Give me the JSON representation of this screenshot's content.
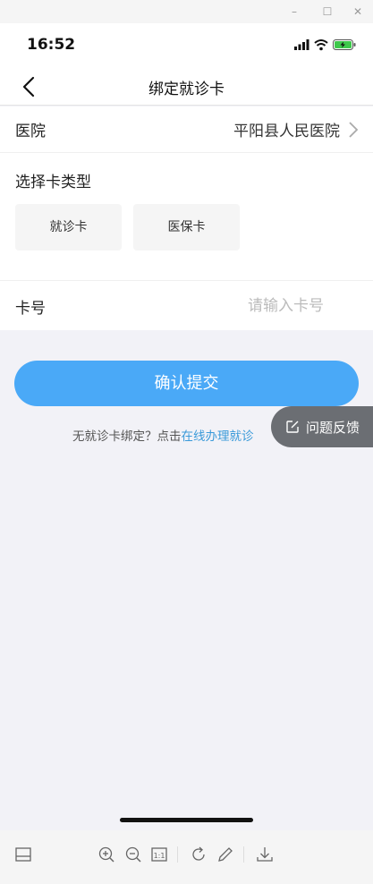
{
  "window_controls": {
    "minimize": "–",
    "maximize": "☐",
    "close": "✕"
  },
  "status_bar": {
    "time": "16:52"
  },
  "nav": {
    "title": "绑定就诊卡"
  },
  "form": {
    "hospital_label": "医院",
    "hospital_value": "平阳县人民医院",
    "card_type_label": "选择卡类型",
    "card_types": [
      "就诊卡",
      "医保卡"
    ],
    "card_number_label": "卡号",
    "card_number_placeholder": "请输入卡号",
    "card_number_value": ""
  },
  "submit": {
    "label": "确认提交"
  },
  "hint": {
    "text": "无就诊卡绑定？点击",
    "link": "在线办理就诊"
  },
  "feedback": {
    "label": "问题反馈"
  },
  "colors": {
    "primary": "#4aa9f7",
    "link": "#3a9ad9",
    "feedback_bg": "#6b6e73",
    "page_bg": "#f2f2f7"
  }
}
